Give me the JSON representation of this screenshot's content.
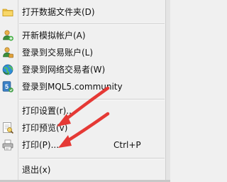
{
  "menu": {
    "items": [
      {
        "label": "打开数据文件夹(D)",
        "icon": "folder-icon"
      },
      {
        "label": "开新模拟帐户(A)",
        "icon": "add-account-icon"
      },
      {
        "label": "登录到交易账户(L)",
        "icon": "login-account-icon"
      },
      {
        "label": "登录到网络交易者(W)",
        "icon": "globe-icon"
      },
      {
        "label": "登录到MQL5.community",
        "icon": "mql5-icon"
      },
      {
        "label": "打印设置(r)..."
      },
      {
        "label": "打印预览(v)",
        "icon": "print-preview-icon"
      },
      {
        "label": "打印(P)...",
        "icon": "printer-icon",
        "shortcut": "Ctrl+P"
      },
      {
        "label": "退出(x)"
      }
    ]
  },
  "annotation": {
    "arrow_color": "#e53935"
  }
}
